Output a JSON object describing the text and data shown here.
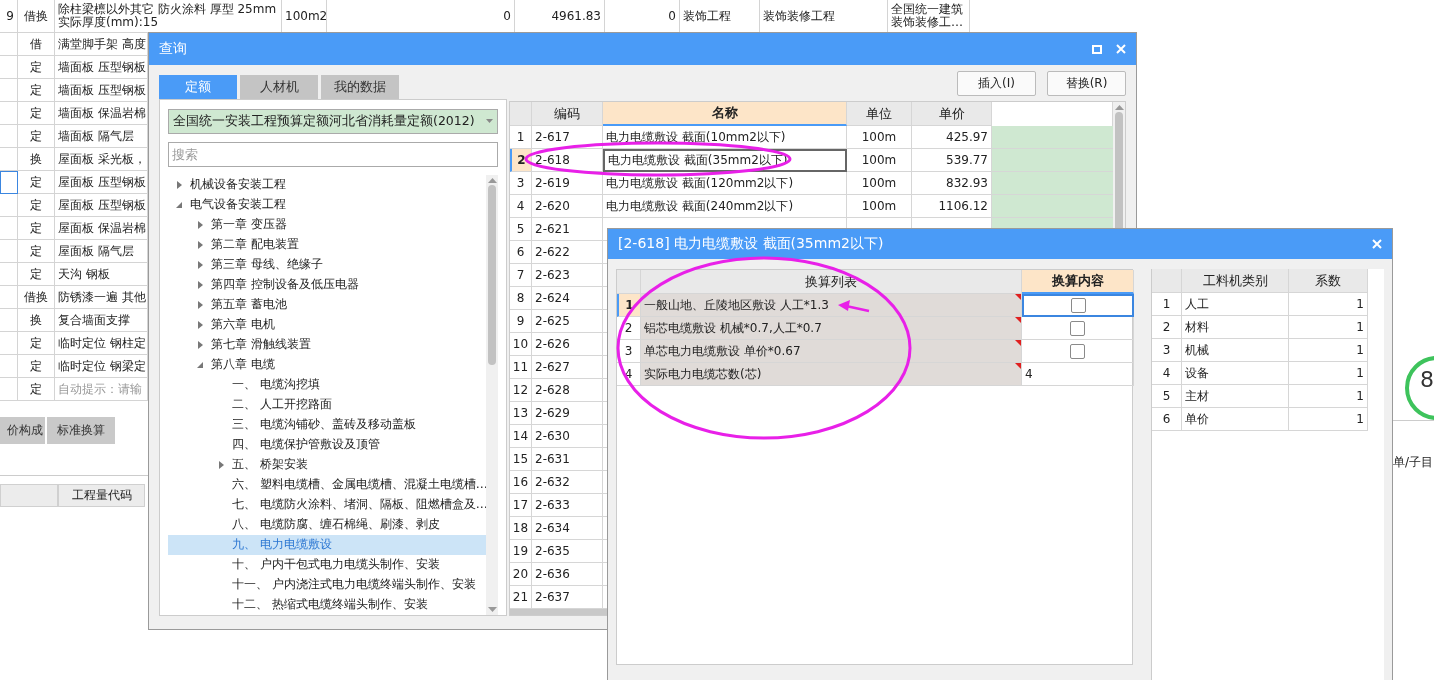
{
  "sheet": {
    "top_row": {
      "cells": [
        "9",
        "借换",
        "除柱梁檩以外其它 防火涂料 厚型 25mm\n 实际厚度(mm):15",
        "100m2",
        "0",
        "4961.83",
        "0",
        "装饰工程",
        "装饰装修工程",
        "全国统一建筑装饰装修工…"
      ]
    },
    "rows": [
      {
        "type": "借",
        "name": "满堂脚手架 高度",
        "selected": false
      },
      {
        "type": "定",
        "name": "墙面板 压型钢板",
        "selected": false
      },
      {
        "type": "定",
        "name": "墙面板 压型钢板",
        "selected": false
      },
      {
        "type": "定",
        "name": "墙面板 保温岩棉",
        "selected": false
      },
      {
        "type": "定",
        "name": "墙面板 隔气层",
        "selected": false
      },
      {
        "type": "换",
        "name": "屋面板 采光板，",
        "selected": false
      },
      {
        "type": "定",
        "name": "屋面板 压型钢板",
        "selected": true
      },
      {
        "type": "定",
        "name": "屋面板 压型钢板",
        "selected": false
      },
      {
        "type": "定",
        "name": "屋面板 保温岩棉",
        "selected": false
      },
      {
        "type": "定",
        "name": "屋面板 隔气层",
        "selected": false
      },
      {
        "type": "定",
        "name": "天沟 钢板",
        "selected": false
      },
      {
        "type": "借换",
        "name": "防锈漆一遍 其他",
        "selected": false
      },
      {
        "type": "换",
        "name": "复合墙面支撑",
        "selected": false
      },
      {
        "type": "定",
        "name": "临时定位 钢柱定",
        "selected": false
      },
      {
        "type": "定",
        "name": "临时定位 钢梁定",
        "selected": false
      },
      {
        "type": "定",
        "placeholder": "自动提示：请输",
        "selected": false
      }
    ]
  },
  "detail_tabs": [
    {
      "label": "价构成"
    },
    {
      "label": "标准换算"
    }
  ],
  "detail_grid": {
    "columns": [
      "工程量代码"
    ]
  },
  "side_label": "单/子目",
  "gauge": {
    "value": "8"
  },
  "query_dialog": {
    "title": "查询",
    "tabs": [
      {
        "label": "定额",
        "selected": true
      },
      {
        "label": "人材机",
        "selected": false
      },
      {
        "label": "我的数据",
        "selected": false
      }
    ],
    "buttons": [
      "插入(I)",
      "替换(R)"
    ],
    "library": {
      "value": "全国统一安装工程预算定额河北省消耗量定额(2012)"
    },
    "search": {
      "placeholder": "搜索"
    },
    "tree": [
      {
        "label": "机械设备安装工程",
        "kind": "folder",
        "expanded": false,
        "selected": false
      },
      {
        "label": "电气设备安装工程",
        "kind": "folder",
        "expanded": true,
        "selected": false,
        "children": [
          {
            "label": "第一章 变压器",
            "kind": "folder",
            "expanded": false,
            "selected": false
          },
          {
            "label": "第二章 配电装置",
            "kind": "folder",
            "expanded": false,
            "selected": false
          },
          {
            "label": "第三章 母线、绝缘子",
            "kind": "folder",
            "expanded": false,
            "selected": false
          },
          {
            "label": "第四章 控制设备及低压电器",
            "kind": "folder",
            "expanded": false,
            "selected": false
          },
          {
            "label": "第五章 蓄电池",
            "kind": "folder",
            "expanded": false,
            "selected": false
          },
          {
            "label": "第六章 电机",
            "kind": "folder",
            "expanded": false,
            "selected": false
          },
          {
            "label": "第七章 滑触线装置",
            "kind": "folder",
            "expanded": false,
            "selected": false
          },
          {
            "label": "第八章 电缆",
            "kind": "folder",
            "expanded": true,
            "selected": false,
            "children": [
              {
                "label": "一、 电缆沟挖填",
                "kind": "leaf",
                "selected": false
              },
              {
                "label": "二、 人工开挖路面",
                "kind": "leaf",
                "selected": false
              },
              {
                "label": "三、 电缆沟铺砂、盖砖及移动盖板",
                "kind": "leaf",
                "selected": false
              },
              {
                "label": "四、 电缆保护管敷设及顶管",
                "kind": "leaf",
                "selected": false
              },
              {
                "label": "五、 桥架安装",
                "kind": "folder",
                "expanded": false,
                "selected": false
              },
              {
                "label": "六、 塑料电缆槽、金属电缆槽、混凝土电缆槽…",
                "kind": "leaf",
                "selected": false
              },
              {
                "label": "七、 电缆防火涂料、堵洞、隔板、阻燃槽盒及…",
                "kind": "leaf",
                "selected": false
              },
              {
                "label": "八、 电缆防腐、缠石棉绳、刷漆、剥皮",
                "kind": "leaf",
                "selected": false
              },
              {
                "label": "九、 电力电缆敷设",
                "kind": "leaf",
                "selected": true
              },
              {
                "label": "十、 户内干包式电力电缆头制作、安装",
                "kind": "leaf",
                "selected": false
              },
              {
                "label": "十一、 户内浇注式电力电缆终端头制作、安装",
                "kind": "leaf",
                "selected": false
              },
              {
                "label": "十二、 热缩式电缆终端头制作、安装",
                "kind": "leaf",
                "selected": false
              }
            ]
          }
        ]
      }
    ],
    "table": {
      "columns": [
        {
          "label": "编码",
          "selected": false
        },
        {
          "label": "名称",
          "selected": true
        },
        {
          "label": "单位",
          "selected": false
        },
        {
          "label": "单价",
          "selected": false
        }
      ],
      "rows": [
        {
          "index": "1",
          "code": "2-617",
          "name": "电力电缆敷设 截面(10mm2以下)",
          "unit": "100m",
          "price": "425.97",
          "selected": false
        },
        {
          "index": "2",
          "code": "2-618",
          "name": "电力电缆敷设 截面(35mm2以下)",
          "unit": "100m",
          "price": "539.77",
          "selected": true
        },
        {
          "index": "3",
          "code": "2-619",
          "name": "电力电缆敷设 截面(120mm2以下)",
          "unit": "100m",
          "price": "832.93",
          "selected": false
        },
        {
          "index": "4",
          "code": "2-620",
          "name": "电力电缆敷设 截面(240mm2以下)",
          "unit": "100m",
          "price": "1106.12",
          "selected": false
        },
        {
          "index": "5",
          "code": "2-621",
          "selected": false
        },
        {
          "index": "6",
          "code": "2-622",
          "selected": false
        },
        {
          "index": "7",
          "code": "2-623",
          "selected": false
        },
        {
          "index": "8",
          "code": "2-624",
          "selected": false
        },
        {
          "index": "9",
          "code": "2-625",
          "selected": false
        },
        {
          "index": "10",
          "code": "2-626",
          "selected": false
        },
        {
          "index": "11",
          "code": "2-627",
          "selected": false
        },
        {
          "index": "12",
          "code": "2-628",
          "selected": false
        },
        {
          "index": "13",
          "code": "2-629",
          "selected": false
        },
        {
          "index": "14",
          "code": "2-630",
          "selected": false
        },
        {
          "index": "15",
          "code": "2-631",
          "selected": false
        },
        {
          "index": "16",
          "code": "2-632",
          "selected": false
        },
        {
          "index": "17",
          "code": "2-633",
          "selected": false
        },
        {
          "index": "18",
          "code": "2-634",
          "selected": false
        },
        {
          "index": "19",
          "code": "2-635",
          "selected": false
        },
        {
          "index": "20",
          "code": "2-636",
          "selected": false
        },
        {
          "index": "21",
          "code": "2-637",
          "selected": false
        }
      ]
    }
  },
  "conversion_dialog": {
    "title": "[2-618] 电力电缆敷设 截面(35mm2以下)",
    "list": {
      "columns": [
        {
          "label": "换算列表",
          "selected": false
        },
        {
          "label": "换算内容",
          "selected": true
        }
      ],
      "rows": [
        {
          "index": "1",
          "name": "一般山地、丘陵地区敷设 人工*1.3",
          "kind": "checkbox",
          "checked": false,
          "selected": true
        },
        {
          "index": "2",
          "name": "铝芯电缆敷设 机械*0.7,人工*0.7",
          "kind": "checkbox",
          "checked": false,
          "selected": false
        },
        {
          "index": "3",
          "name": "单芯电力电缆敷设 单价*0.67",
          "kind": "checkbox",
          "checked": false,
          "selected": false
        },
        {
          "index": "4",
          "name": "实际电力电缆芯数(芯)",
          "kind": "value",
          "value": "4",
          "selected": false
        }
      ]
    },
    "factors": {
      "columns": [
        "工料机类别",
        "系数"
      ],
      "rows": [
        {
          "index": "1",
          "category": "人工",
          "factor": "1"
        },
        {
          "index": "2",
          "category": "材料",
          "factor": "1"
        },
        {
          "index": "3",
          "category": "机械",
          "factor": "1"
        },
        {
          "index": "4",
          "category": "设备",
          "factor": "1"
        },
        {
          "index": "5",
          "category": "主材",
          "factor": "1"
        },
        {
          "index": "6",
          "category": "单价",
          "factor": "1"
        }
      ]
    }
  }
}
